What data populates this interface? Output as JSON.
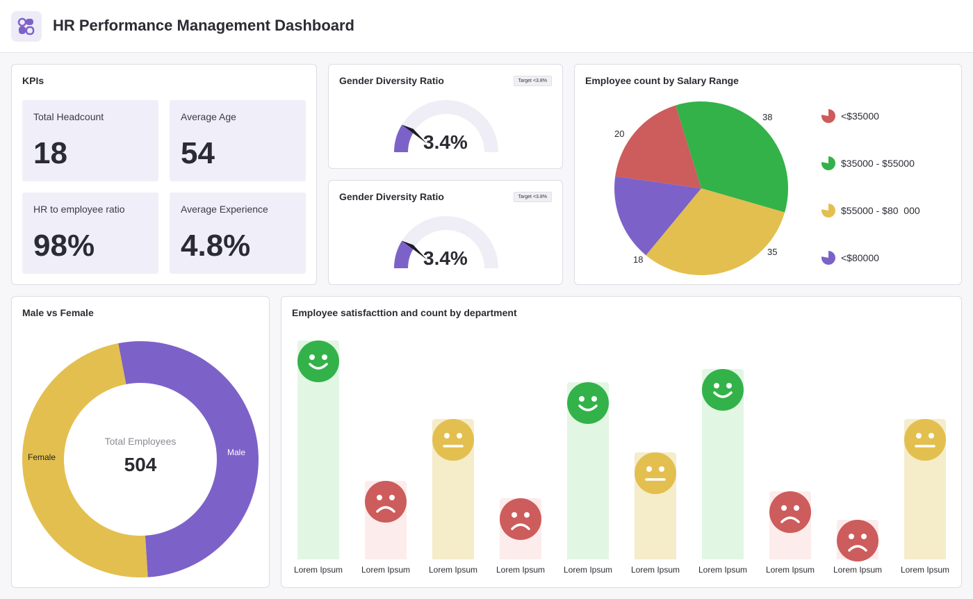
{
  "header": {
    "title": "HR Performance Management Dashboard",
    "logo_icon": "app-logo-icon"
  },
  "kpis": {
    "title": "KPIs",
    "tiles": [
      {
        "label": "Total Headcount",
        "value": "18"
      },
      {
        "label": "Average Age",
        "value": "54"
      },
      {
        "label": "HR to employee ratio",
        "value": "98%"
      },
      {
        "label": "Average Experience",
        "value": "4.8%"
      }
    ]
  },
  "gauges": [
    {
      "title": "Gender Diversity Ratio",
      "target": "Target <3.8%",
      "value": "3.4%",
      "level": 0.034
    },
    {
      "title": "Gender Diversity Ratio",
      "target": "Target <3.8%",
      "value": "3.4%",
      "level": 0.034
    }
  ],
  "salary": {
    "title": "Employee count by Salary Range",
    "legend": [
      "<$35000",
      "$35000 - $55000",
      "$55000 - $80  000",
      "<$80000"
    ],
    "slice_labels": [
      "20",
      "38",
      "35",
      "18"
    ]
  },
  "gender": {
    "title": "Male vs Female",
    "center_label": "Total Employees",
    "center_value": "504",
    "male_label": "Male",
    "female_label": "Female"
  },
  "department": {
    "title": "Employee satisfacttion and count by department",
    "labels": [
      "Lorem Ipsum",
      "Lorem Ipsum",
      "Lorem Ipsum",
      "Lorem Ipsum",
      "Lorem Ipsum",
      "Lorem Ipsum",
      "Lorem Ipsum",
      "Lorem Ipsum",
      "Lorem Ipsum",
      "Lorem Ipsum"
    ]
  },
  "colors": {
    "red": "#cd5c5c",
    "green": "#33b24a",
    "yellow": "#e3bf4f",
    "purple": "#7c62c8",
    "green_light": "#e2f6e4",
    "red_light": "#fdecec",
    "yellow_light": "#f5ecc9",
    "gauge_track": "#efeef6"
  },
  "chart_data": [
    {
      "type": "pie",
      "title": "Employee count by Salary Range",
      "categories": [
        "<$35000",
        "$35000 - $55000",
        "$55000 - $80  000",
        "<$80000"
      ],
      "values": [
        20,
        38,
        35,
        18
      ],
      "colors": [
        "#cd5c5c",
        "#33b24a",
        "#e3bf4f",
        "#7c62c8"
      ],
      "legend": "right"
    },
    {
      "type": "pie",
      "title": "Male vs Female",
      "categories": [
        "Male",
        "Female"
      ],
      "values": [
        0.52,
        0.48
      ],
      "colors": [
        "#7c62c8",
        "#e3bf4f"
      ]
    },
    {
      "type": "bar",
      "title": "Employee satisfacttion and count by department",
      "categories": [
        "Lorem Ipsum",
        "Lorem Ipsum",
        "Lorem Ipsum",
        "Lorem Ipsum",
        "Lorem Ipsum",
        "Lorem Ipsum",
        "Lorem Ipsum",
        "Lorem Ipsum",
        "Lorem Ipsum",
        "Lorem Ipsum"
      ],
      "values": [
        10,
        3.6,
        6.4,
        2.8,
        8.1,
        4.9,
        8.7,
        3.1,
        1.8,
        6.4
      ],
      "satisfaction": [
        "happy",
        "sad",
        "neutral",
        "sad",
        "happy",
        "neutral",
        "happy",
        "sad",
        "sad",
        "neutral"
      ],
      "ylim": [
        0,
        10
      ]
    }
  ]
}
